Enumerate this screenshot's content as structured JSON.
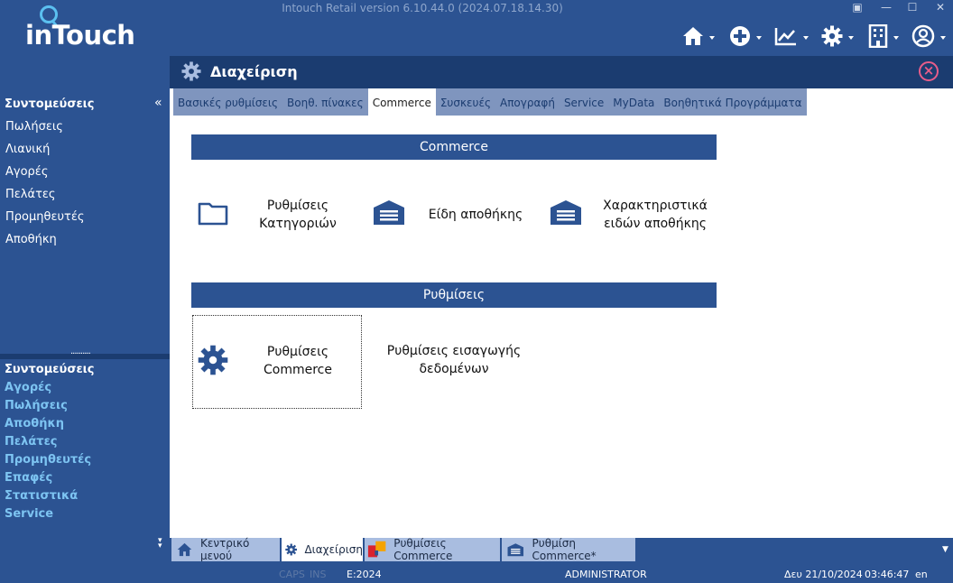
{
  "app": {
    "title": "Intouch Retail version 6.10.44.0 (2024.07.18.14.30)",
    "logo_text": "inTouch"
  },
  "toolbar": {
    "icons": [
      "home-icon",
      "plus-circle-icon",
      "chart-icon",
      "gear-icon",
      "building-icon",
      "user-icon"
    ]
  },
  "sidebar": {
    "shortcuts_title": "Συντομεύσεις",
    "collapse_glyph": "«",
    "items": [
      {
        "label": "Πωλήσεις"
      },
      {
        "label": "Λιανική"
      },
      {
        "label": "Αγορές"
      },
      {
        "label": "Πελάτες"
      },
      {
        "label": "Προμηθευτές"
      },
      {
        "label": "Αποθήκη"
      }
    ],
    "splitter_dots": "..........",
    "shortcuts_title_2": "Συντομεύσεις",
    "shortcuts": [
      {
        "label": "Αγορές"
      },
      {
        "label": "Πωλήσεις"
      },
      {
        "label": "Αποθήκη"
      },
      {
        "label": "Πελάτες"
      },
      {
        "label": "Προμηθευτές"
      },
      {
        "label": "Επαφές"
      },
      {
        "label": "Στατιστικά"
      },
      {
        "label": "Service"
      }
    ]
  },
  "panel": {
    "title": "Διαχείριση",
    "close_glyph": "×",
    "tabs": [
      {
        "label": "Βασικές ρυθμίσεις"
      },
      {
        "label": "Βοηθ. πίνακες"
      },
      {
        "label": "Commerce"
      },
      {
        "label": "Συσκευές"
      },
      {
        "label": "Απογραφή"
      },
      {
        "label": "Service"
      },
      {
        "label": "MyData"
      },
      {
        "label": "Βοηθητικά Προγράμματα"
      }
    ],
    "active_tab": "Commerce"
  },
  "sections": [
    {
      "title": "Commerce",
      "cards": [
        {
          "line1": "Ρυθμίσεις",
          "line2": "Κατηγοριών",
          "icon": "folder-icon"
        },
        {
          "line1": "Είδη αποθήκης",
          "line2": "",
          "icon": "warehouse-icon"
        },
        {
          "line1": "Χαρακτηριστικά",
          "line2": "ειδών αποθήκης",
          "icon": "warehouse-icon"
        }
      ]
    },
    {
      "title": "Ρυθμίσεις",
      "cards": [
        {
          "line1": "Ρυθμίσεις",
          "line2": "Commerce",
          "icon": "gear-icon"
        },
        {
          "line1": "Ρυθμίσεις εισαγωγής",
          "line2": "δεδομένων",
          "icon": ""
        }
      ]
    }
  ],
  "bottom_tabs": [
    {
      "label": "Κεντρικό μενού",
      "icon": "home-icon"
    },
    {
      "label": "Διαχείριση",
      "icon": "gear-icon"
    },
    {
      "label": "Ρυθμίσεις Commerce",
      "icon": "colored-squares-icon"
    },
    {
      "label": "Ρυθμίση Commerce*",
      "icon": "warehouse-icon"
    }
  ],
  "status": {
    "caps": "CAPS",
    "ins": "INS",
    "year": "E:2024",
    "user": "ADMINISTRATOR",
    "date": "Δευ 21/10/2024",
    "time": "03:46:47",
    "lang": "en"
  },
  "colors": {
    "primary": "#2c5392",
    "dark": "#1b3c70",
    "tab_strip": "#7f95be",
    "shortcut_link": "#7dc4f2",
    "close_accent": "#e85d8a"
  }
}
